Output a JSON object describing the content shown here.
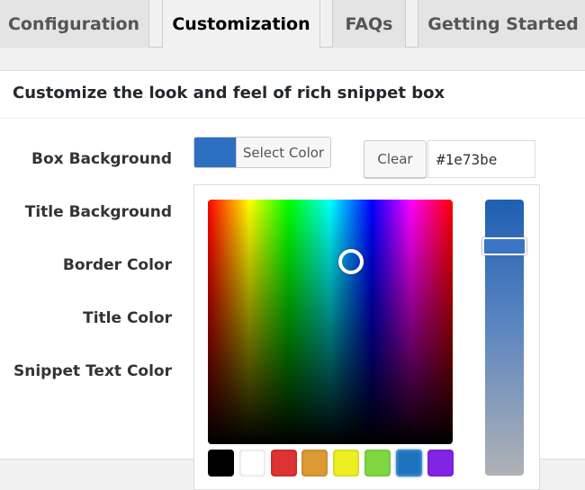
{
  "tabs": [
    "Configuration",
    "Customization",
    "FAQs",
    "Getting Started"
  ],
  "heading": "Customize the look and feel of rich snippet box",
  "labels": [
    "Box Background",
    "Title Background",
    "Border Color",
    "Title Color",
    "Snippet Text Color"
  ],
  "select_color": "Select Color",
  "clear": "Clear",
  "hex_value": "#1e73be",
  "current_color": "#1e73be",
  "palette": [
    "#000000",
    "#ffffff",
    "#dd3333",
    "#dd9933",
    "#eeee22",
    "#81d742",
    "#1e73be",
    "#8224e3"
  ]
}
